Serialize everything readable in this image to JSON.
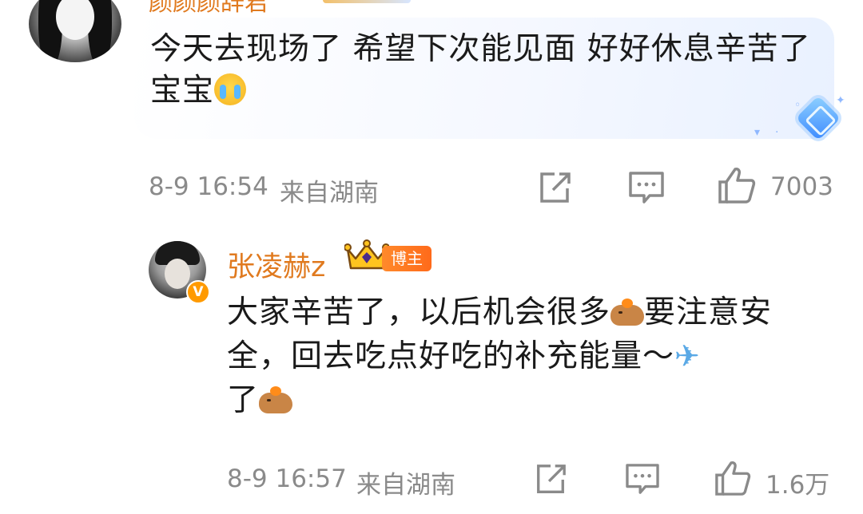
{
  "comment1": {
    "author_name": "颜颜颜辞君",
    "text": "今天去现场了 希望下次能见面 好好休息辛苦了宝宝",
    "emoji": "crying-emoji",
    "time": "8-9 16:54",
    "location": "来自湖南",
    "like_count": "7003"
  },
  "reply": {
    "author_name": "张凌赫z",
    "badge_label": "博主",
    "verified_badge": "V",
    "text_part1": "大家辛苦了，以后机会很多",
    "text_part2": "要注意安全，回去吃点好吃的补充能量～",
    "text_part3": "了",
    "time": "8-9 16:57",
    "location": "来自湖南",
    "like_count": "1.6万"
  },
  "colors": {
    "name": "#e07a1f",
    "meta": "#8a8a8a",
    "badge": "#ff7a1f"
  },
  "icons": [
    "share-icon",
    "comment-icon",
    "like-icon",
    "vip-diamond-icon",
    "crown-icon",
    "capybara-emoji",
    "airplane-emoji"
  ]
}
